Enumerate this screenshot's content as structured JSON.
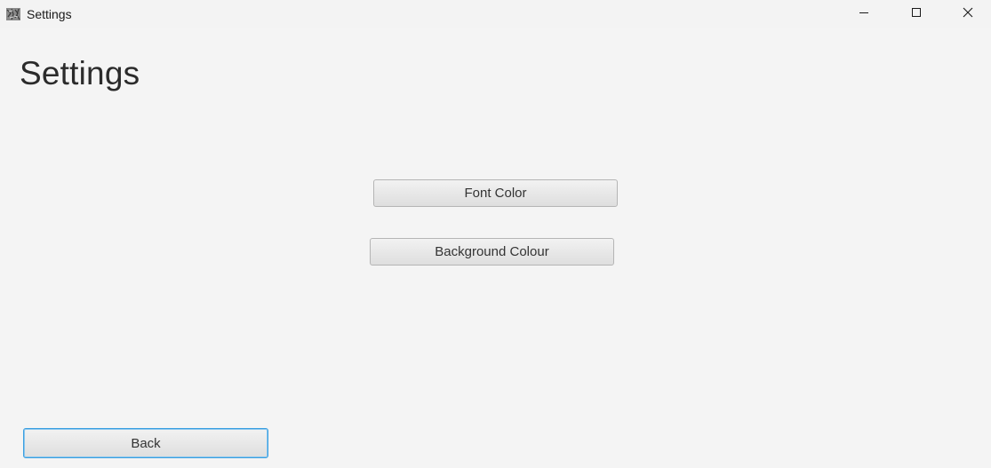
{
  "window": {
    "title": "Settings"
  },
  "page": {
    "title": "Settings"
  },
  "buttons": {
    "font_color": "Font Color",
    "background_colour": "Background Colour",
    "back": "Back"
  },
  "icons": {
    "app": "app-icon",
    "minimize": "minimize-icon",
    "maximize": "maximize-icon",
    "close": "close-icon"
  },
  "colors": {
    "background": "#f4f4f4",
    "focus_border": "#3b9fe0"
  }
}
